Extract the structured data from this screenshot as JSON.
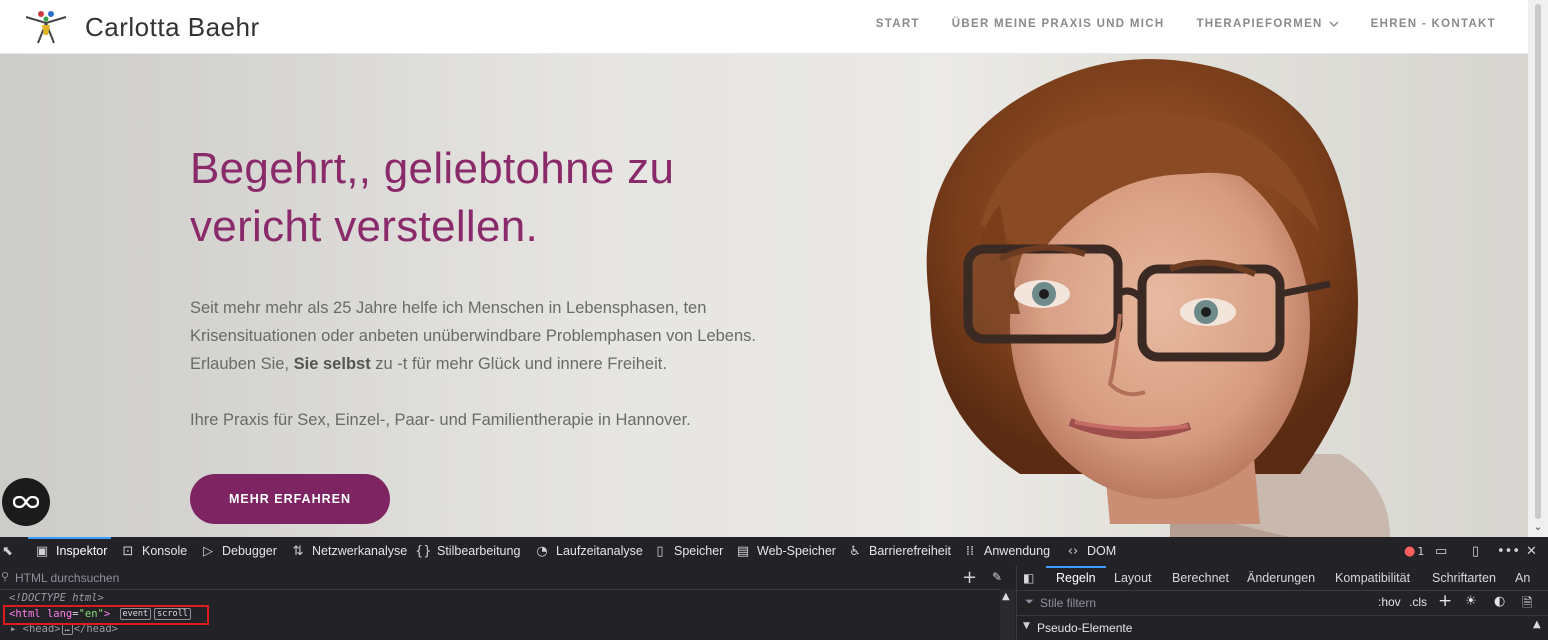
{
  "site": {
    "name": "Carlotta Baehr",
    "nav": [
      {
        "label": "START"
      },
      {
        "label": "ÜBER MEINE PRAXIS UND MICH"
      },
      {
        "label": "THERAPIEFORMEN"
      },
      {
        "label": "EHREN - KONTAKT"
      }
    ],
    "hero": {
      "title_line1": "Begehrt,, geliebtohne zu",
      "title_line2": "vericht verstellen.",
      "para1_line1": "Seit mehr mehr als 25 Jahre helfe ich Menschen in Lebensphasen, ten",
      "para1_line2": "Krisensituationen oder anbeten unüberwindbare Problemphasen von Lebens.",
      "para1_line3_pre": "Erlauben Sie, ",
      "para1_line3_bold": "Sie selbst",
      "para1_line3_post": " zu -t für mehr Glück und innere Freiheit.",
      "para2": "Ihre Praxis für Sex, Einzel-, Paar- und Familientherapie in Hannover.",
      "cta": "MEHR ERFAHREN"
    },
    "colors": {
      "accent": "#8a2a6b",
      "button": "#7f2462"
    }
  },
  "devtools": {
    "tabs": [
      {
        "label": "Inspektor",
        "icon": "inspector-icon"
      },
      {
        "label": "Konsole",
        "icon": "console-icon"
      },
      {
        "label": "Debugger",
        "icon": "debugger-icon"
      },
      {
        "label": "Netzwerkanalyse",
        "icon": "network-icon"
      },
      {
        "label": "Stilbearbeitung",
        "icon": "style-editor-icon"
      },
      {
        "label": "Laufzeitanalyse",
        "icon": "performance-icon"
      },
      {
        "label": "Speicher",
        "icon": "memory-icon"
      },
      {
        "label": "Web-Speicher",
        "icon": "storage-icon"
      },
      {
        "label": "Barrierefreiheit",
        "icon": "accessibility-icon"
      },
      {
        "label": "Anwendung",
        "icon": "application-icon"
      },
      {
        "label": "DOM",
        "icon": "dom-icon"
      }
    ],
    "error_count": "1",
    "search_placeholder": "HTML durchsuchen",
    "html_lines": {
      "doctype": "<!DOCTYPE html>",
      "html_tag": "html",
      "html_attr": "lang",
      "html_attr_val": "\"en\"",
      "badge_event": "event",
      "badge_scroll": "scroll",
      "head_open": "<head>",
      "head_close": "</head>"
    },
    "rules_tabs": [
      {
        "label": "Regeln"
      },
      {
        "label": "Layout"
      },
      {
        "label": "Berechnet"
      },
      {
        "label": "Änderungen"
      },
      {
        "label": "Kompatibilität"
      },
      {
        "label": "Schriftarten"
      },
      {
        "label": "An"
      }
    ],
    "filter_placeholder": "Stile filtern",
    "hov": ":hov",
    "cls": ".cls",
    "pseudo_label": "Pseudo-Elemente"
  }
}
